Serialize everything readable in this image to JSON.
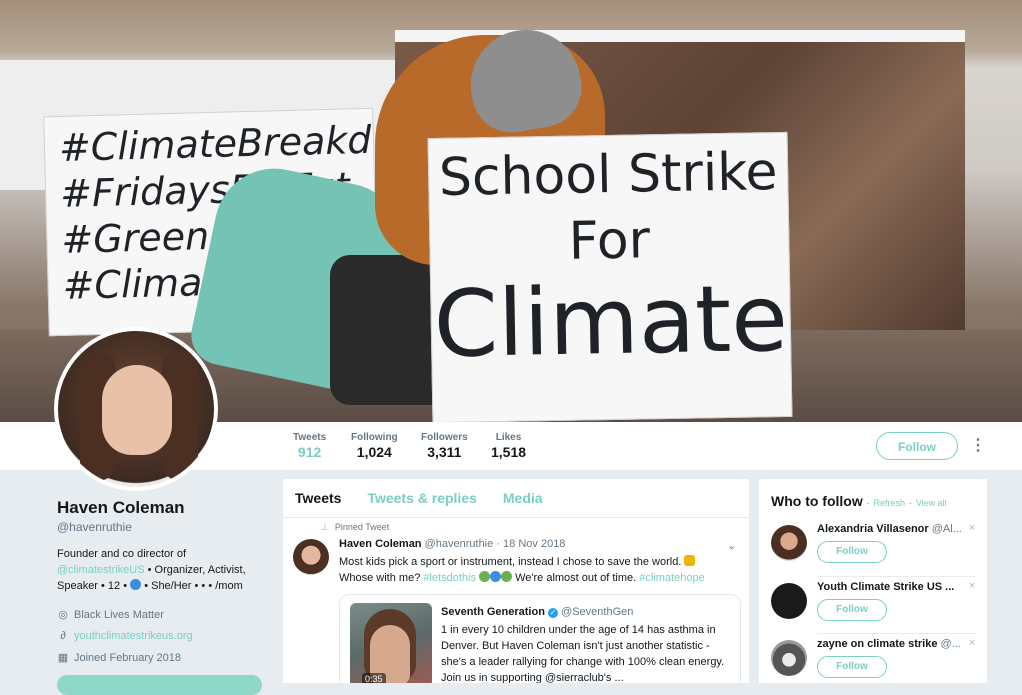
{
  "banner": {
    "sign_left_lines": [
      "#ClimateBreakdown",
      "#FridaysForFut",
      "#GreenNe",
      "#ClimateSt"
    ],
    "sign_right_lines": [
      "School Strike",
      "For",
      "Climate"
    ]
  },
  "nav": {
    "stats": [
      {
        "label": "Tweets",
        "value": "912"
      },
      {
        "label": "Following",
        "value": "1,024"
      },
      {
        "label": "Followers",
        "value": "3,311"
      },
      {
        "label": "Likes",
        "value": "1,518"
      }
    ],
    "follow_label": "Follow",
    "more_label": "⋮"
  },
  "profile": {
    "name": "Haven Coleman",
    "handle": "@havenruthie",
    "bio_1": "Founder and co director of",
    "bio_link": "@climatestrikeUS",
    "bio_2": " • Organizer, Activist,",
    "bio_3a": "Speaker • 12 • ",
    "bio_3b": " • She/Her • • • /mom",
    "location": "Black Lives Matter",
    "website": "youthclimatestrikeus.org",
    "joined": "Joined February 2018"
  },
  "timeline": {
    "tabs": [
      "Tweets",
      "Tweets & replies",
      "Media"
    ],
    "pinned_label": "Pinned Tweet",
    "tweet": {
      "name": "Haven Coleman",
      "handle": "@havenruthie",
      "sep": "·",
      "date": "18 Nov 2018",
      "text_1": "Most kids pick a sport or instrument, instead I chose to save the world. ",
      "text_2a": "Whose with me? ",
      "tag_1": "#letsdothis",
      "text_2b": " We're almost out of time. ",
      "tag_2": "#climatehope"
    },
    "quote": {
      "name": "Seventh Generation",
      "handle": "@SeventhGen",
      "duration": "0:35",
      "text": "1 in every 10 children under the age of 14 has asthma in Denver. But Haven Coleman isn't just another statistic - she's a leader rallying for change with 100% clean energy. Join us in supporting @sierraclub's ..."
    }
  },
  "who_to_follow": {
    "title": "Who to follow",
    "refresh": "Refresh",
    "dot": "·",
    "view_all": "View all",
    "follow_label": "Follow",
    "close_label": "×",
    "items": [
      {
        "name": "Alexandria Villasenor",
        "handle": "@Al..."
      },
      {
        "name": "Youth Climate Strike US ...",
        "handle": ""
      },
      {
        "name": "zayne on climate strike",
        "handle": "@..."
      }
    ]
  },
  "colors": {
    "accent": "#79cfc2",
    "text": "#14171a",
    "muted": "#657786",
    "bg": "#e6ecf0"
  }
}
